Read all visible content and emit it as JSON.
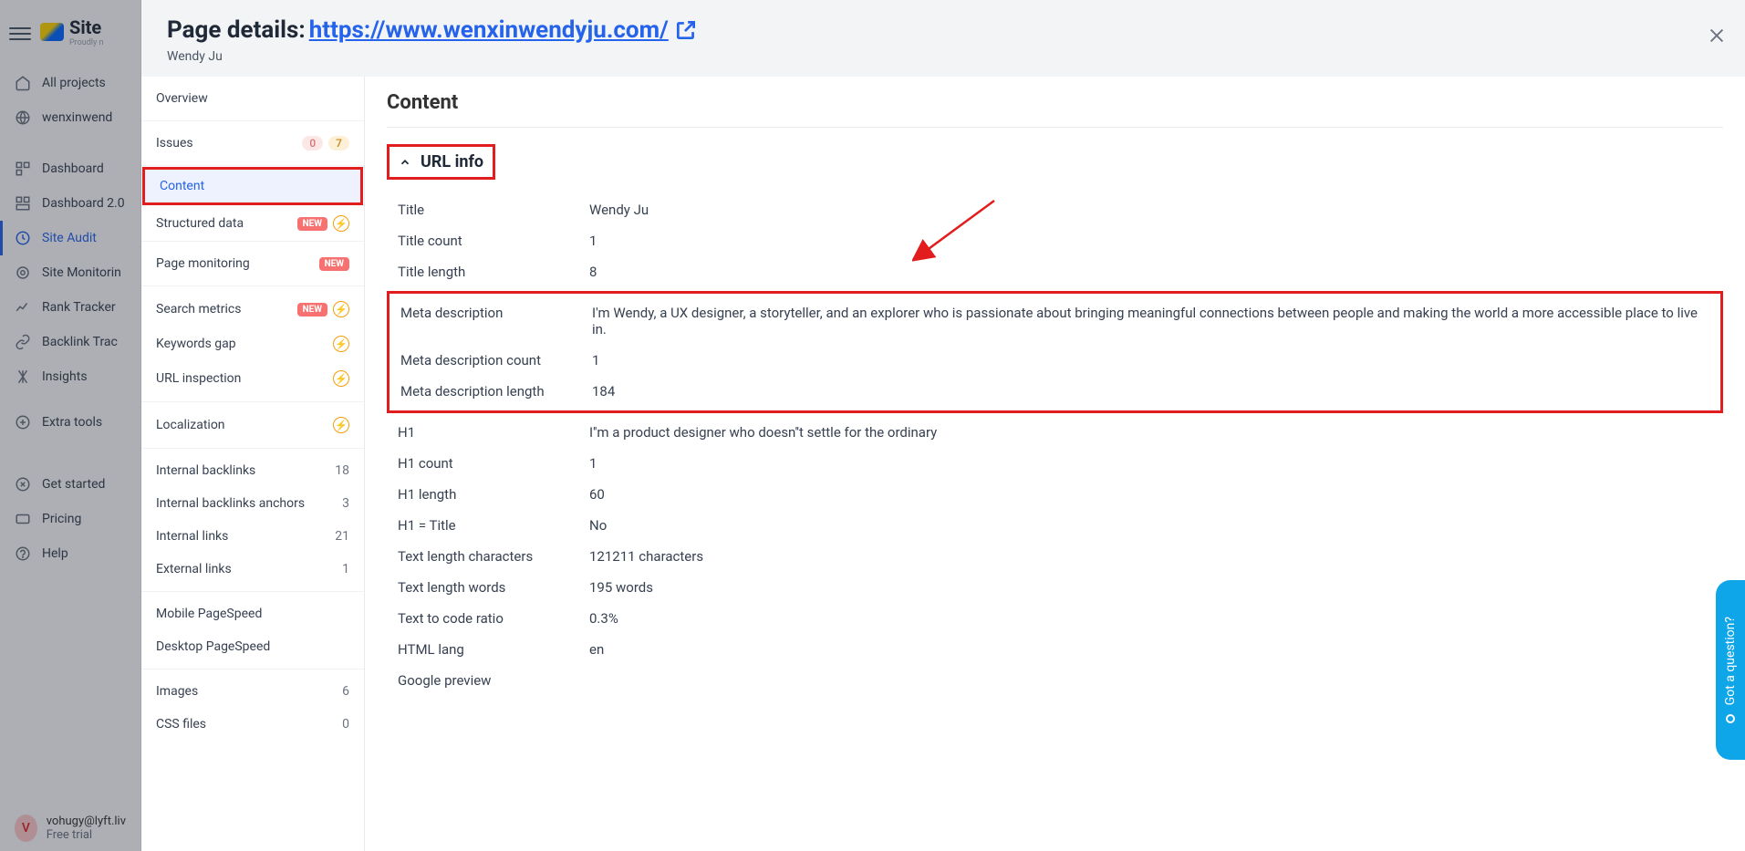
{
  "logo": {
    "text": "Site",
    "sub": "Proudly n"
  },
  "bgSidebar": {
    "allProjects": "All projects",
    "project": "wenxinwend",
    "items": [
      {
        "label": "Dashboard"
      },
      {
        "label": "Dashboard 2.0"
      },
      {
        "label": "Site Audit"
      },
      {
        "label": "Site Monitorin"
      },
      {
        "label": "Rank Tracker"
      },
      {
        "label": "Backlink Trac"
      },
      {
        "label": "Insights"
      }
    ],
    "extraTools": "Extra tools",
    "getStarted": "Get started",
    "pricing": "Pricing",
    "help": "Help",
    "user": {
      "initial": "V",
      "email": "vohugy@lyft.liv",
      "plan": "Free trial"
    }
  },
  "modal": {
    "titlePrefix": "Page details: ",
    "url": "https://www.wenxinwendyju.com/",
    "subtitle": "Wendy Ju"
  },
  "detailNav": {
    "overview": "Overview",
    "issues": {
      "label": "Issues",
      "pink": "0",
      "yellow": "7"
    },
    "content": "Content",
    "structured": "Structured data",
    "pageMonitoring": "Page monitoring",
    "searchMetrics": "Search metrics",
    "keywordsGap": "Keywords gap",
    "urlInspection": "URL inspection",
    "localization": "Localization",
    "internalBacklinks": {
      "label": "Internal backlinks",
      "count": "18"
    },
    "internalBacklinksAnchors": {
      "label": "Internal backlinks anchors",
      "count": "3"
    },
    "internalLinks": {
      "label": "Internal links",
      "count": "21"
    },
    "externalLinks": {
      "label": "External links",
      "count": "1"
    },
    "mobilePS": "Mobile PageSpeed",
    "desktopPS": "Desktop PageSpeed",
    "images": {
      "label": "Images",
      "count": "6"
    },
    "cssFiles": {
      "label": "CSS files",
      "count": "0"
    },
    "newBadge": "NEW"
  },
  "content": {
    "heading": "Content",
    "sectionTitle": "URL info",
    "rows": {
      "title": {
        "k": "Title",
        "v": "Wendy Ju"
      },
      "titleCount": {
        "k": "Title count",
        "v": "1"
      },
      "titleLength": {
        "k": "Title length",
        "v": "8"
      },
      "metaDesc": {
        "k": "Meta description",
        "v": "I'm Wendy, a UX designer, a storyteller, and an explorer who is passionate about bringing meaningful connections between people and making the world a more accessible place to live in."
      },
      "metaDescCount": {
        "k": "Meta description count",
        "v": "1"
      },
      "metaDescLength": {
        "k": "Meta description length",
        "v": "184"
      },
      "h1": {
        "k": "H1",
        "v": "I''m a product designer who doesn''t settle for the ordinary"
      },
      "h1Count": {
        "k": "H1 count",
        "v": "1"
      },
      "h1Length": {
        "k": "H1 length",
        "v": "60"
      },
      "h1EqTitle": {
        "k": "H1 = Title",
        "v": "No"
      },
      "textChars": {
        "k": "Text length characters",
        "v": "121211 characters"
      },
      "textWords": {
        "k": "Text length words",
        "v": "195 words"
      },
      "textRatio": {
        "k": "Text to code ratio",
        "v": "0.3%"
      },
      "htmlLang": {
        "k": "HTML lang",
        "v": "en"
      },
      "googlePreview": {
        "k": "Google preview",
        "v": ""
      }
    }
  },
  "helpBubble": "Got a question?"
}
